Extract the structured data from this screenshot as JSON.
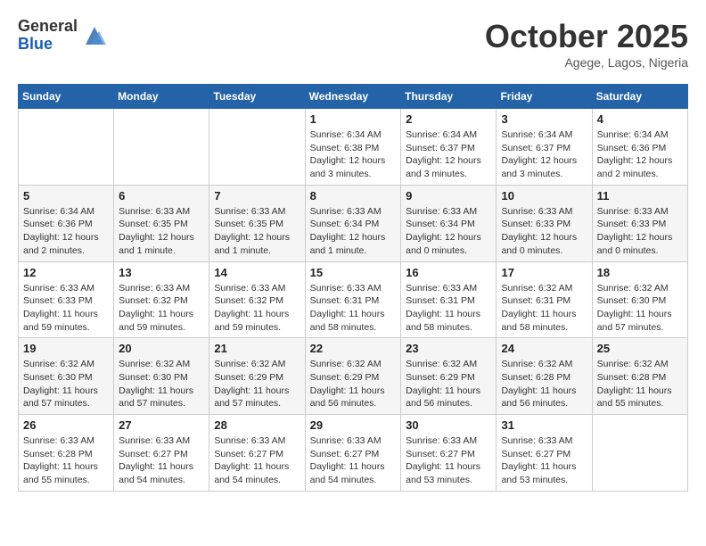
{
  "logo": {
    "general": "General",
    "blue": "Blue"
  },
  "title": "October 2025",
  "location": "Agege, Lagos, Nigeria",
  "days_of_week": [
    "Sunday",
    "Monday",
    "Tuesday",
    "Wednesday",
    "Thursday",
    "Friday",
    "Saturday"
  ],
  "weeks": [
    [
      {
        "day": "",
        "info": ""
      },
      {
        "day": "",
        "info": ""
      },
      {
        "day": "",
        "info": ""
      },
      {
        "day": "1",
        "info": "Sunrise: 6:34 AM\nSunset: 6:38 PM\nDaylight: 12 hours\nand 3 minutes."
      },
      {
        "day": "2",
        "info": "Sunrise: 6:34 AM\nSunset: 6:37 PM\nDaylight: 12 hours\nand 3 minutes."
      },
      {
        "day": "3",
        "info": "Sunrise: 6:34 AM\nSunset: 6:37 PM\nDaylight: 12 hours\nand 3 minutes."
      },
      {
        "day": "4",
        "info": "Sunrise: 6:34 AM\nSunset: 6:36 PM\nDaylight: 12 hours\nand 2 minutes."
      }
    ],
    [
      {
        "day": "5",
        "info": "Sunrise: 6:34 AM\nSunset: 6:36 PM\nDaylight: 12 hours\nand 2 minutes."
      },
      {
        "day": "6",
        "info": "Sunrise: 6:33 AM\nSunset: 6:35 PM\nDaylight: 12 hours\nand 1 minute."
      },
      {
        "day": "7",
        "info": "Sunrise: 6:33 AM\nSunset: 6:35 PM\nDaylight: 12 hours\nand 1 minute."
      },
      {
        "day": "8",
        "info": "Sunrise: 6:33 AM\nSunset: 6:34 PM\nDaylight: 12 hours\nand 1 minute."
      },
      {
        "day": "9",
        "info": "Sunrise: 6:33 AM\nSunset: 6:34 PM\nDaylight: 12 hours\nand 0 minutes."
      },
      {
        "day": "10",
        "info": "Sunrise: 6:33 AM\nSunset: 6:33 PM\nDaylight: 12 hours\nand 0 minutes."
      },
      {
        "day": "11",
        "info": "Sunrise: 6:33 AM\nSunset: 6:33 PM\nDaylight: 12 hours\nand 0 minutes."
      }
    ],
    [
      {
        "day": "12",
        "info": "Sunrise: 6:33 AM\nSunset: 6:33 PM\nDaylight: 11 hours\nand 59 minutes."
      },
      {
        "day": "13",
        "info": "Sunrise: 6:33 AM\nSunset: 6:32 PM\nDaylight: 11 hours\nand 59 minutes."
      },
      {
        "day": "14",
        "info": "Sunrise: 6:33 AM\nSunset: 6:32 PM\nDaylight: 11 hours\nand 59 minutes."
      },
      {
        "day": "15",
        "info": "Sunrise: 6:33 AM\nSunset: 6:31 PM\nDaylight: 11 hours\nand 58 minutes."
      },
      {
        "day": "16",
        "info": "Sunrise: 6:33 AM\nSunset: 6:31 PM\nDaylight: 11 hours\nand 58 minutes."
      },
      {
        "day": "17",
        "info": "Sunrise: 6:32 AM\nSunset: 6:31 PM\nDaylight: 11 hours\nand 58 minutes."
      },
      {
        "day": "18",
        "info": "Sunrise: 6:32 AM\nSunset: 6:30 PM\nDaylight: 11 hours\nand 57 minutes."
      }
    ],
    [
      {
        "day": "19",
        "info": "Sunrise: 6:32 AM\nSunset: 6:30 PM\nDaylight: 11 hours\nand 57 minutes."
      },
      {
        "day": "20",
        "info": "Sunrise: 6:32 AM\nSunset: 6:30 PM\nDaylight: 11 hours\nand 57 minutes."
      },
      {
        "day": "21",
        "info": "Sunrise: 6:32 AM\nSunset: 6:29 PM\nDaylight: 11 hours\nand 57 minutes."
      },
      {
        "day": "22",
        "info": "Sunrise: 6:32 AM\nSunset: 6:29 PM\nDaylight: 11 hours\nand 56 minutes."
      },
      {
        "day": "23",
        "info": "Sunrise: 6:32 AM\nSunset: 6:29 PM\nDaylight: 11 hours\nand 56 minutes."
      },
      {
        "day": "24",
        "info": "Sunrise: 6:32 AM\nSunset: 6:28 PM\nDaylight: 11 hours\nand 56 minutes."
      },
      {
        "day": "25",
        "info": "Sunrise: 6:32 AM\nSunset: 6:28 PM\nDaylight: 11 hours\nand 55 minutes."
      }
    ],
    [
      {
        "day": "26",
        "info": "Sunrise: 6:33 AM\nSunset: 6:28 PM\nDaylight: 11 hours\nand 55 minutes."
      },
      {
        "day": "27",
        "info": "Sunrise: 6:33 AM\nSunset: 6:27 PM\nDaylight: 11 hours\nand 54 minutes."
      },
      {
        "day": "28",
        "info": "Sunrise: 6:33 AM\nSunset: 6:27 PM\nDaylight: 11 hours\nand 54 minutes."
      },
      {
        "day": "29",
        "info": "Sunrise: 6:33 AM\nSunset: 6:27 PM\nDaylight: 11 hours\nand 54 minutes."
      },
      {
        "day": "30",
        "info": "Sunrise: 6:33 AM\nSunset: 6:27 PM\nDaylight: 11 hours\nand 53 minutes."
      },
      {
        "day": "31",
        "info": "Sunrise: 6:33 AM\nSunset: 6:27 PM\nDaylight: 11 hours\nand 53 minutes."
      },
      {
        "day": "",
        "info": ""
      }
    ]
  ]
}
